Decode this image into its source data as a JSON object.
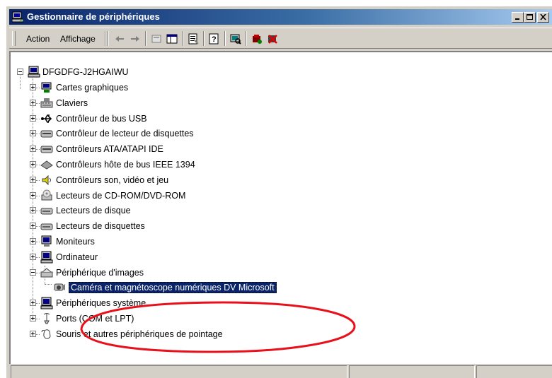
{
  "window": {
    "title": "Gestionnaire de périphériques"
  },
  "caption_buttons": [
    "minimize",
    "maximize",
    "close"
  ],
  "menu": {
    "action": "Action",
    "display": "Affichage"
  },
  "toolbar_icons": [
    "back-icon",
    "forward-icon",
    "up-icon",
    "show-hide-tree-icon",
    "properties-icon",
    "help-icon",
    "scan-hardware-icon",
    "update-driver-icon",
    "uninstall-icon"
  ],
  "tree": {
    "root": "DFGDFG-J2HGAIWU",
    "items": [
      {
        "label": "Cartes graphiques",
        "icon": "display-adapter-icon",
        "expanded": false
      },
      {
        "label": "Claviers",
        "icon": "keyboard-icon",
        "expanded": false
      },
      {
        "label": "Contrôleur de bus USB",
        "icon": "usb-icon",
        "expanded": false
      },
      {
        "label": "Contrôleur de lecteur de disquettes",
        "icon": "floppy-controller-icon",
        "expanded": false
      },
      {
        "label": "Contrôleurs ATA/ATAPI IDE",
        "icon": "ide-controller-icon",
        "expanded": false
      },
      {
        "label": "Contrôleurs hôte de bus IEEE 1394",
        "icon": "firewire-icon",
        "expanded": false
      },
      {
        "label": "Contrôleurs son, vidéo et jeu",
        "icon": "sound-icon",
        "expanded": false
      },
      {
        "label": "Lecteurs de CD-ROM/DVD-ROM",
        "icon": "cdrom-icon",
        "expanded": false
      },
      {
        "label": "Lecteurs de disque",
        "icon": "disk-drive-icon",
        "expanded": false
      },
      {
        "label": "Lecteurs de disquettes",
        "icon": "floppy-drive-icon",
        "expanded": false
      },
      {
        "label": "Moniteurs",
        "icon": "monitor-icon",
        "expanded": false
      },
      {
        "label": "Ordinateur",
        "icon": "computer-icon",
        "expanded": false
      },
      {
        "label": "Périphérique d'images",
        "icon": "imaging-device-icon",
        "expanded": true
      },
      {
        "label": "Caméra et magnétoscope numériques DV Microsoft",
        "icon": "camera-icon",
        "child": true,
        "selected": true
      },
      {
        "label": "Périphériques système",
        "icon": "system-devices-icon",
        "expanded": false
      },
      {
        "label": "Ports (COM et LPT)",
        "icon": "port-icon",
        "expanded": false
      },
      {
        "label": "Souris et autres périphériques de pointage",
        "icon": "mouse-icon",
        "expanded": false
      }
    ]
  },
  "annotation": {
    "shape": "ellipse",
    "color": "#e8101a",
    "highlights": "Caméra et magnétoscope numériques DV Microsoft"
  },
  "colors": {
    "titlebar_start": "#0a246a",
    "titlebar_end": "#a6caf0",
    "selection": "#0a246a",
    "face": "#d4d0c8"
  }
}
